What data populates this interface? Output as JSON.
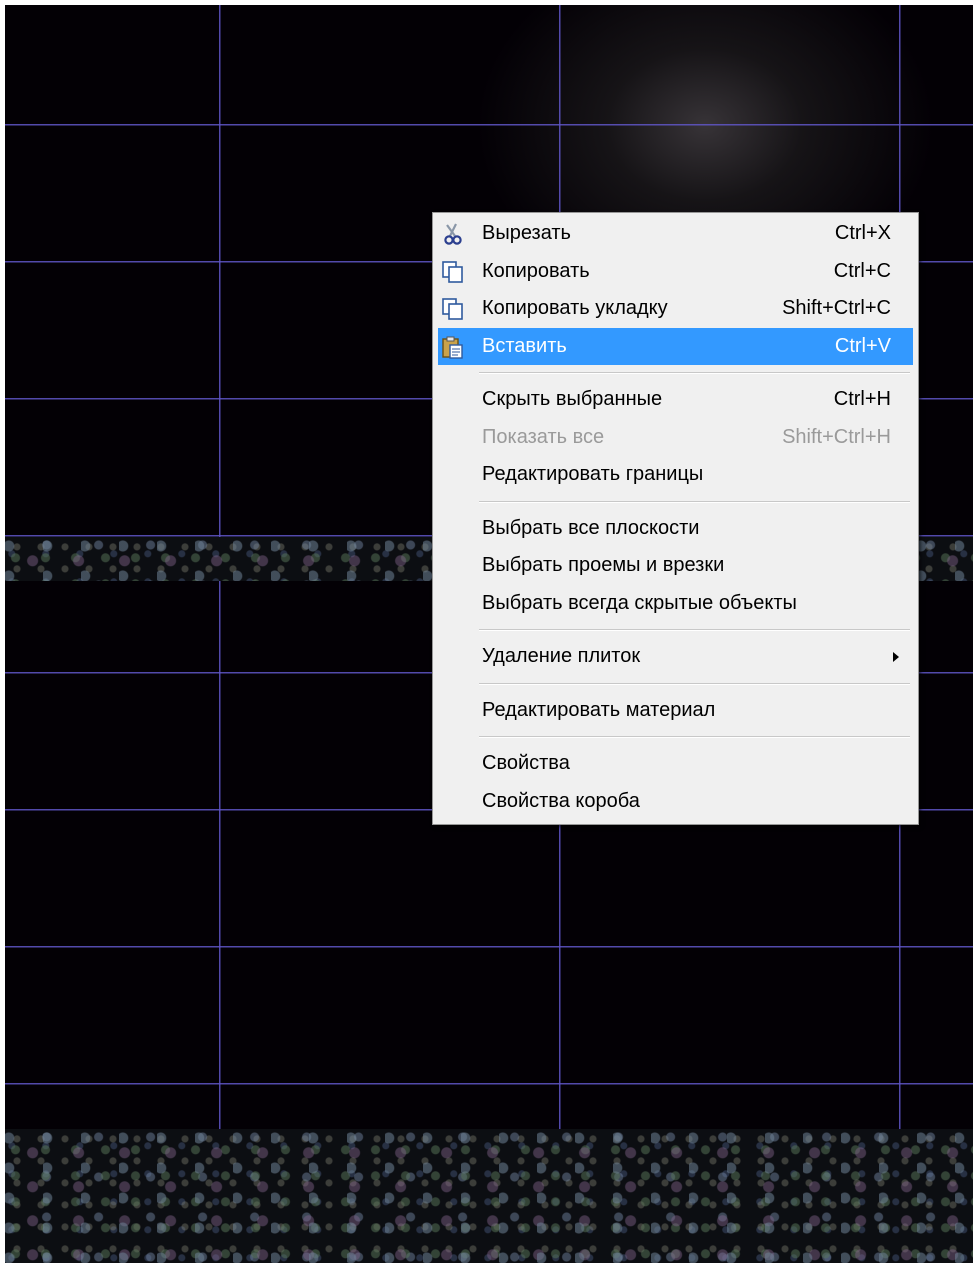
{
  "context_menu": {
    "items": [
      {
        "label": "Вырезать",
        "shortcut": "Ctrl+X",
        "icon": "scissors-icon"
      },
      {
        "label": "Копировать",
        "shortcut": "Ctrl+C",
        "icon": "copy-icon"
      },
      {
        "label": "Копировать укладку",
        "shortcut": "Shift+Ctrl+C",
        "icon": "copy-icon"
      },
      {
        "label": "Вставить",
        "shortcut": "Ctrl+V",
        "icon": "paste-icon",
        "highlighted": true
      },
      {
        "label": "Скрыть выбранные",
        "shortcut": "Ctrl+H"
      },
      {
        "label": "Показать все",
        "shortcut": "Shift+Ctrl+H",
        "disabled": true
      },
      {
        "label": "Редактировать границы"
      },
      {
        "label": "Выбрать все плоскости"
      },
      {
        "label": "Выбрать проемы и врезки"
      },
      {
        "label": "Выбрать всегда скрытые объекты"
      },
      {
        "label": "Удаление плиток",
        "submenu": true
      },
      {
        "label": "Редактировать материал"
      },
      {
        "label": "Свойства"
      },
      {
        "label": "Свойства короба"
      }
    ]
  },
  "colors": {
    "highlight": "#3399ff",
    "menu_background": "#f0f0f0",
    "disabled_text": "#9a9a9a",
    "tile_grid": "#6056c8",
    "viewport_background": "#030005"
  }
}
